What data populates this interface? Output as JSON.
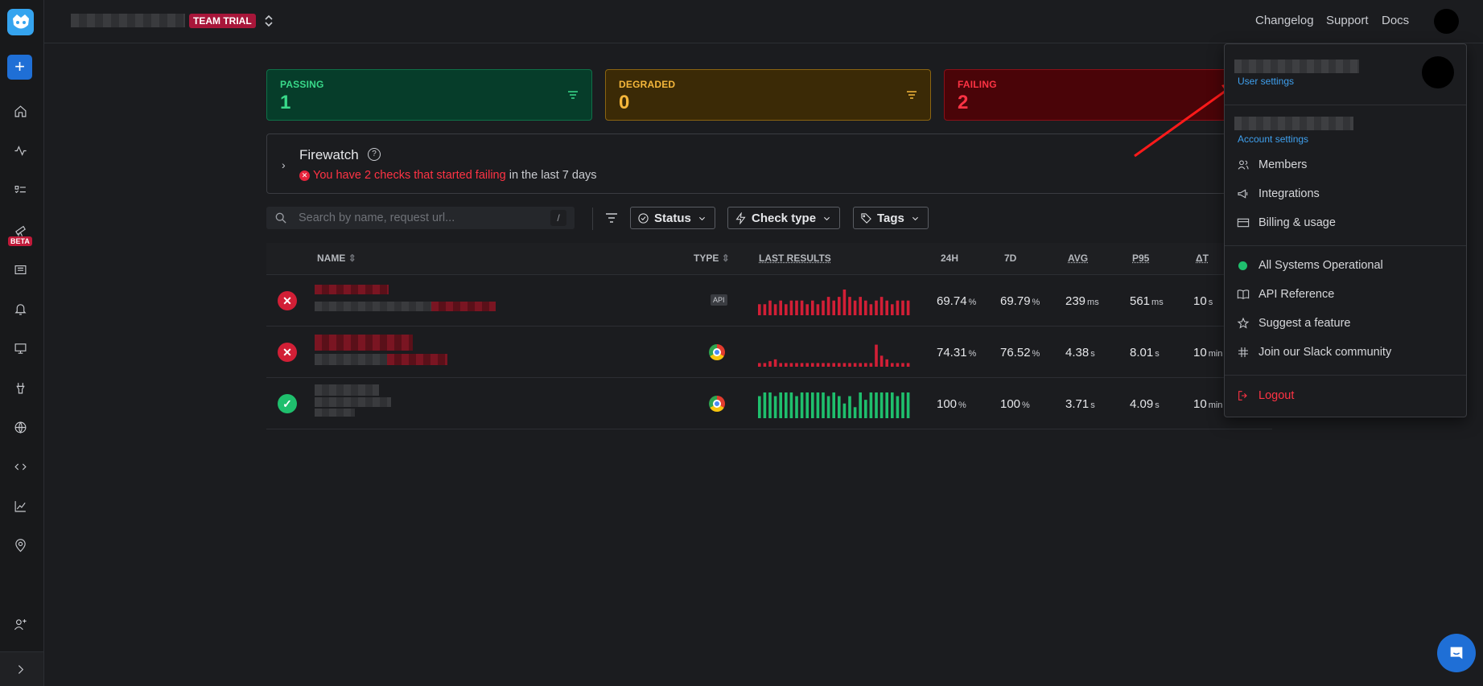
{
  "topbar": {
    "team_badge": "TEAM TRIAL",
    "links": [
      "Changelog",
      "Support",
      "Docs"
    ]
  },
  "sidebar": {
    "beta_label": "BETA"
  },
  "cards": [
    {
      "label": "PASSING",
      "count": "1"
    },
    {
      "label": "DEGRADED",
      "count": "0"
    },
    {
      "label": "FAILING",
      "count": "2"
    }
  ],
  "firewatch": {
    "title": "Firewatch",
    "alert": "You have 2 checks that started failing",
    "suffix": " in the last 7 days"
  },
  "search": {
    "placeholder": "Search by name, request url...",
    "shortcut": "/"
  },
  "filters": {
    "status": "Status",
    "check_type": "Check type",
    "tags": "Tags"
  },
  "table": {
    "headers": {
      "name": "NAME",
      "type": "TYPE",
      "last_results": "LAST RESULTS",
      "h24": "24H",
      "d7": "7D",
      "avg": "AVG",
      "p95": "P95",
      "dt": "ΔT"
    },
    "rows": [
      {
        "status": "failing",
        "type": "API",
        "h24": "69.74",
        "h24_unit": "%",
        "d7": "69.79",
        "d7_unit": "%",
        "avg": "239",
        "avg_unit": "ms",
        "p95": "561",
        "p95_unit": "ms",
        "dt": "10",
        "dt_unit": "s",
        "results": [
          3,
          3,
          4,
          3,
          4,
          3,
          4,
          4,
          4,
          3,
          4,
          3,
          4,
          5,
          4,
          5,
          7,
          5,
          4,
          5,
          4,
          3,
          4,
          5,
          4,
          3,
          4,
          4,
          4
        ]
      },
      {
        "status": "failing",
        "type": "Browser",
        "h24": "74.31",
        "h24_unit": "%",
        "d7": "76.52",
        "d7_unit": "%",
        "avg": "4.38",
        "avg_unit": "s",
        "p95": "8.01",
        "p95_unit": "s",
        "dt": "10",
        "dt_unit": "min",
        "results": [
          1,
          1,
          1.5,
          2,
          1,
          1,
          1,
          1,
          1,
          1,
          1,
          1,
          1,
          1,
          1,
          1,
          1,
          1,
          1,
          1,
          1,
          1,
          6,
          3,
          2,
          1,
          1,
          1,
          1
        ]
      },
      {
        "status": "passing",
        "type": "Browser",
        "h24": "100",
        "h24_unit": "%",
        "d7": "100",
        "d7_unit": "%",
        "avg": "3.71",
        "avg_unit": "s",
        "p95": "4.09",
        "p95_unit": "s",
        "dt": "10",
        "dt_unit": "min",
        "results": [
          6,
          7,
          7,
          6,
          7,
          7,
          7,
          6,
          7,
          7,
          7,
          7,
          7,
          6,
          7,
          6,
          4,
          6,
          3,
          7,
          5,
          7,
          7,
          7,
          7,
          7,
          6,
          7,
          7
        ]
      }
    ]
  },
  "menu": {
    "user_settings": "User settings",
    "account_settings": "Account settings",
    "items": [
      "Members",
      "Integrations",
      "Billing & usage"
    ],
    "status": "All Systems Operational",
    "links": [
      "API Reference",
      "Suggest a feature",
      "Join our Slack community"
    ],
    "logout": "Logout"
  },
  "colors": {
    "fail": "#d21f36",
    "pass": "#1fbf6d",
    "accent": "#1f6fd6"
  }
}
